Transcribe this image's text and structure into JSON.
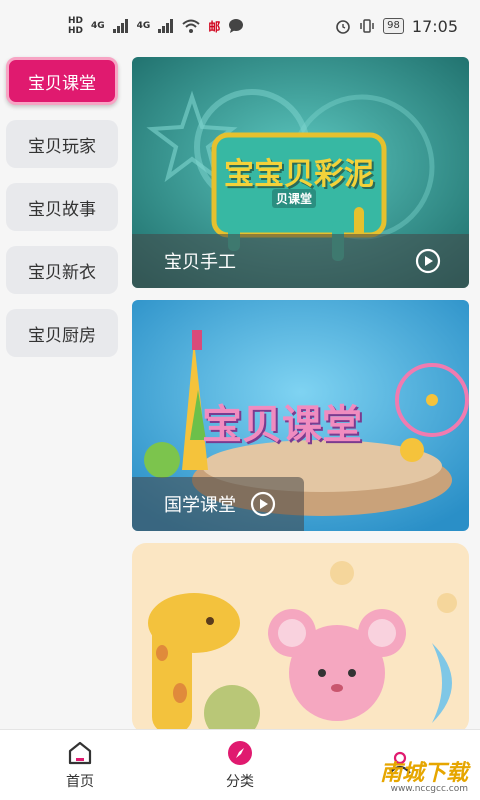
{
  "status_bar": {
    "left_tiny": [
      "HD",
      "HD"
    ],
    "signal1": "4G",
    "signal2": "4G",
    "carrier_icon": "邮",
    "time": "17:05",
    "battery": "98"
  },
  "sidebar": {
    "items": [
      {
        "label": "宝贝课堂",
        "active": true
      },
      {
        "label": "宝贝玩家",
        "active": false
      },
      {
        "label": "宝贝故事",
        "active": false
      },
      {
        "label": "宝贝新衣",
        "active": false
      },
      {
        "label": "宝贝厨房",
        "active": false
      }
    ]
  },
  "cards": [
    {
      "title": "宝贝手工",
      "image_text": "宝宝贝彩泥",
      "image_sub": "贝课堂"
    },
    {
      "title": "国学课堂",
      "image_text": "宝贝课堂"
    },
    {
      "title": ""
    }
  ],
  "bottom_nav": {
    "items": [
      {
        "label": "首页",
        "icon": "home-icon"
      },
      {
        "label": "分类",
        "icon": "compass-icon"
      },
      {
        "label": "",
        "icon": "user-icon"
      }
    ]
  },
  "watermark": {
    "main": "南城下载",
    "sub": "www.nccgcc.com"
  },
  "colors": {
    "accent": "#e01a6f",
    "card1_bg": "#2f8f8a",
    "card2_bg": "#3aa6d6"
  }
}
